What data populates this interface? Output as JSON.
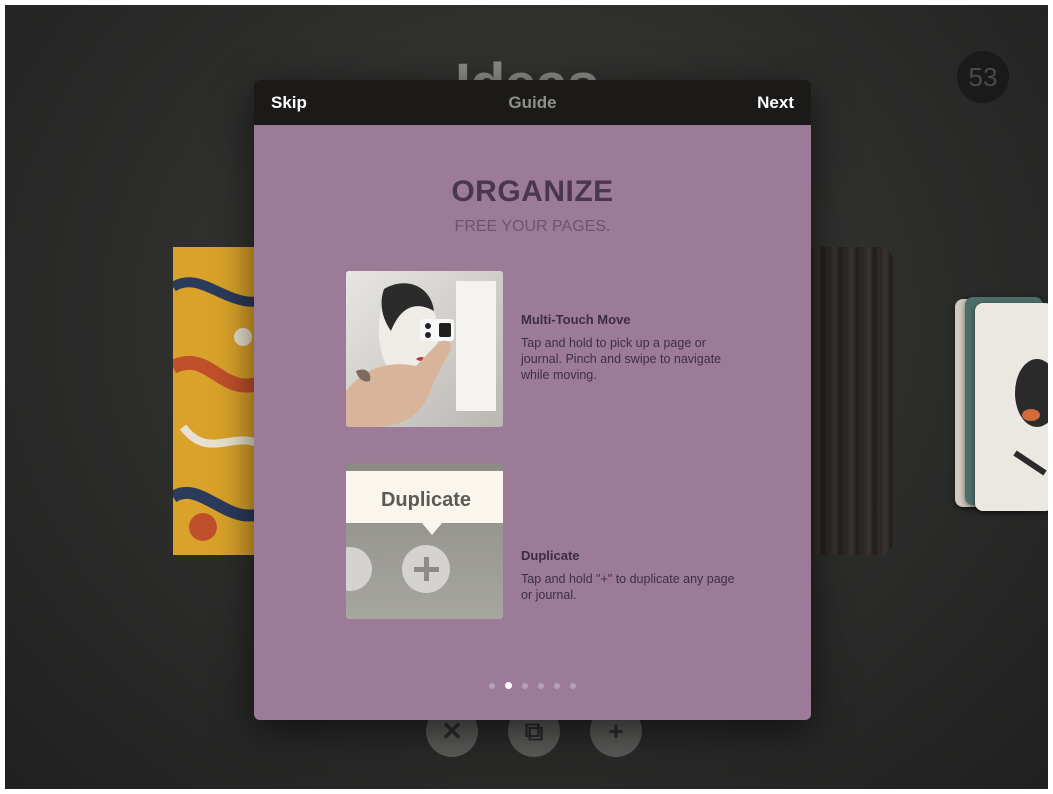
{
  "background": {
    "title": "Ideas",
    "page_count": "53",
    "bottom_actions": [
      {
        "icon": "close-icon",
        "glyph": "✕"
      },
      {
        "icon": "duplicate-icon",
        "glyph": "⧉"
      },
      {
        "icon": "add-icon",
        "glyph": "+"
      }
    ]
  },
  "guide": {
    "header": {
      "skip_label": "Skip",
      "title": "Guide",
      "next_label": "Next"
    },
    "heading": "ORGANIZE",
    "subheading": "FREE YOUR PAGES.",
    "features": [
      {
        "title": "Multi-Touch Move",
        "description": "Tap and hold to pick up a page or journal.  Pinch and swipe to navigate while moving.",
        "image_icon": "multi-touch-photo"
      },
      {
        "title": "Duplicate",
        "description": "Tap and hold \"+\" to duplicate any page or journal.",
        "image_icon": "duplicate-tooltip",
        "image_tooltip_label": "Duplicate"
      }
    ],
    "pagination": {
      "total": 6,
      "current": 2
    }
  },
  "colors": {
    "panel": "#9b7b98",
    "header": "#1b1a18",
    "heading": "#4b3650"
  }
}
